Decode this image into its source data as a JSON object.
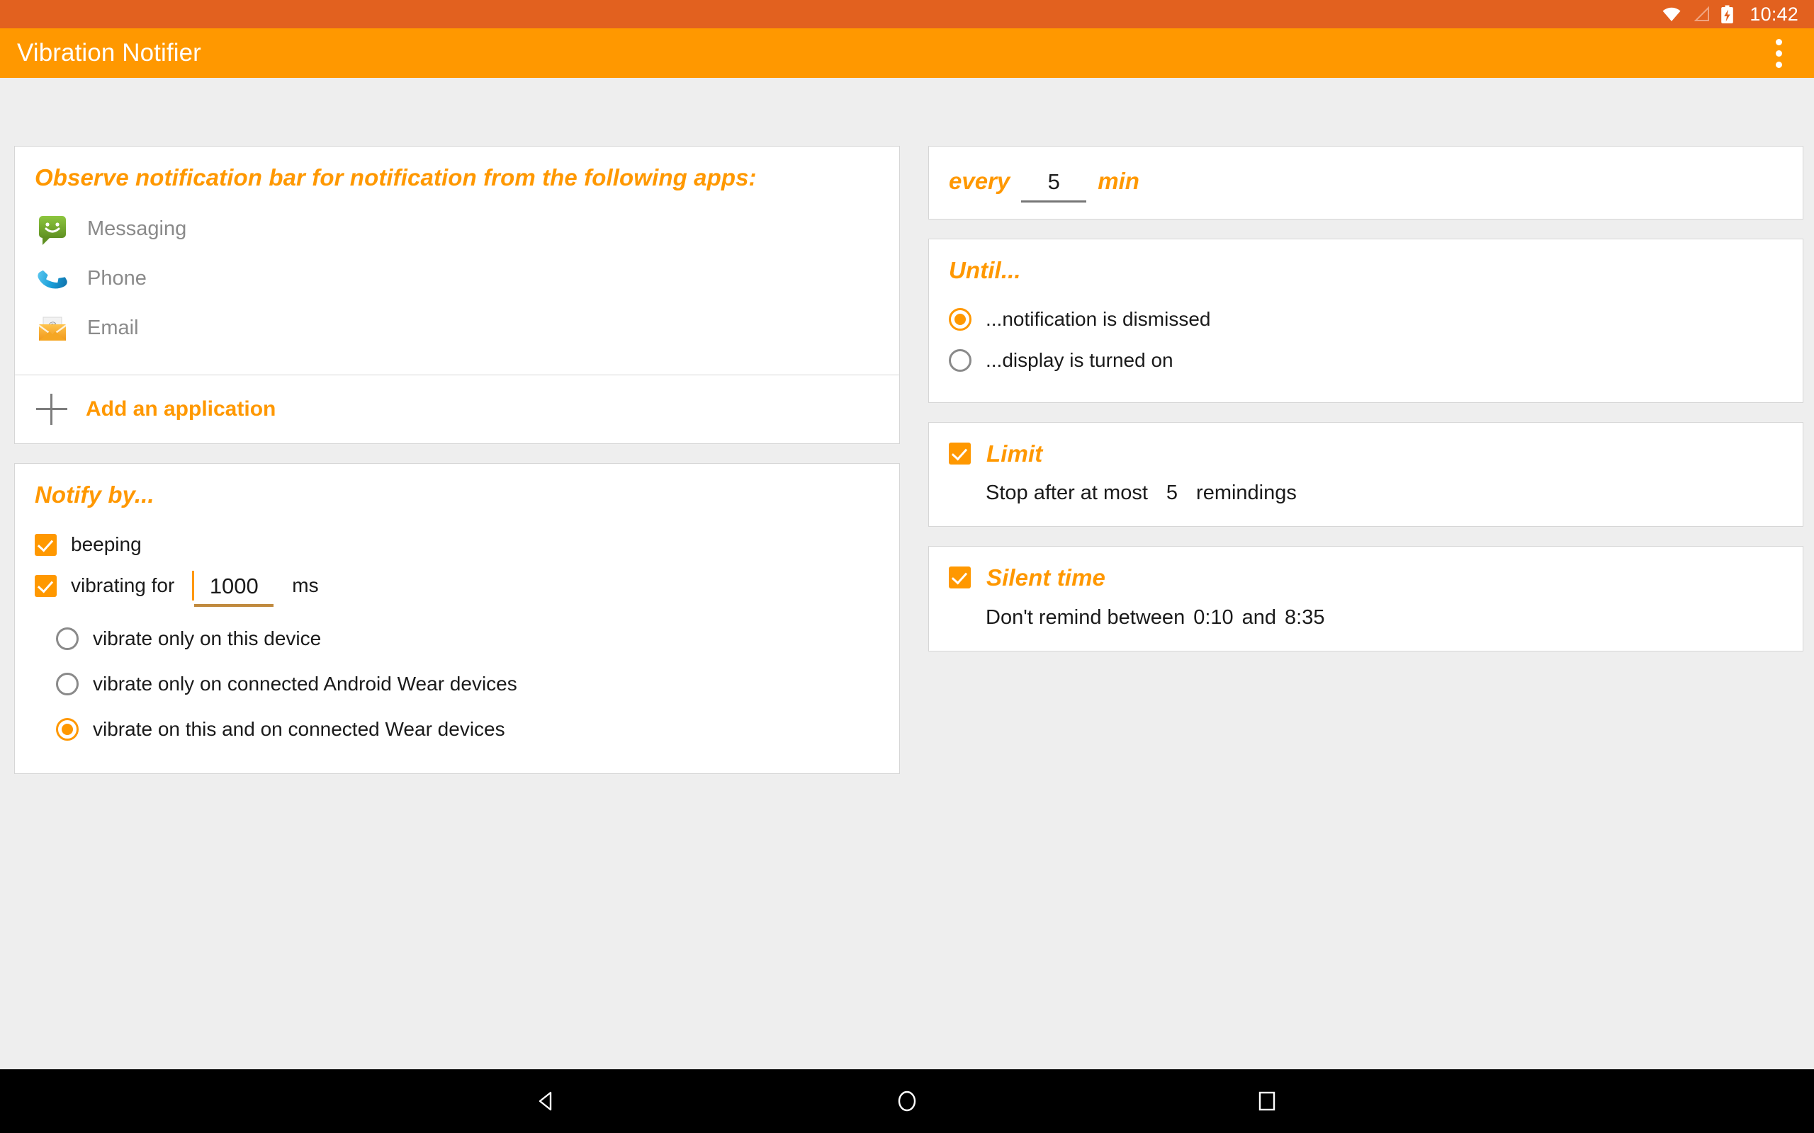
{
  "status_bar": {
    "time": "10:42",
    "icons": [
      "wifi-icon",
      "cell-signal-icon",
      "battery-charging-icon"
    ],
    "background_color": "#e2611f"
  },
  "app_bar": {
    "title": "Vibration Notifier",
    "overflow_menu": "overflow-menu-icon",
    "background_color": "#ff9800"
  },
  "theme": {
    "accent": "#ff9800",
    "background": "#eeeeee",
    "card": "#ffffff",
    "text": "#1a1a1a",
    "muted_text": "#8a8a8a"
  },
  "observe_card": {
    "heading": "Observe notification bar for notification from the following apps:",
    "apps": [
      {
        "name": "Messaging",
        "icon": "messaging-icon"
      },
      {
        "name": "Phone",
        "icon": "phone-icon"
      },
      {
        "name": "Email",
        "icon": "email-icon"
      }
    ],
    "add_label": "Add an application",
    "add_icon": "plus-icon"
  },
  "notify_card": {
    "heading": "Notify by...",
    "beeping": {
      "label": "beeping",
      "checked": true
    },
    "vibrating": {
      "label": "vibrating for",
      "checked": true,
      "value": "1000",
      "unit": "ms"
    },
    "vibrate_targets": [
      {
        "label": "vibrate only on this device",
        "selected": false
      },
      {
        "label": "vibrate only on connected Android Wear devices",
        "selected": false
      },
      {
        "label": "vibrate on this and on connected Wear devices",
        "selected": true
      }
    ]
  },
  "interval_card": {
    "prefix": "every",
    "value": "5",
    "suffix": "min"
  },
  "until_card": {
    "heading": "Until...",
    "options": [
      {
        "label": "...notification is dismissed",
        "selected": true
      },
      {
        "label": "...display is turned on",
        "selected": false
      }
    ]
  },
  "limit_card": {
    "heading": "Limit",
    "checked": true,
    "prefix": "Stop after at most",
    "value": "5",
    "suffix": "remindings"
  },
  "silent_card": {
    "heading": "Silent time",
    "checked": true,
    "prefix": "Don't remind between",
    "start": "0:10",
    "joiner": "and",
    "end": "8:35"
  },
  "nav_bar": {
    "back": "back-icon",
    "home": "home-icon",
    "recents": "recents-icon"
  }
}
